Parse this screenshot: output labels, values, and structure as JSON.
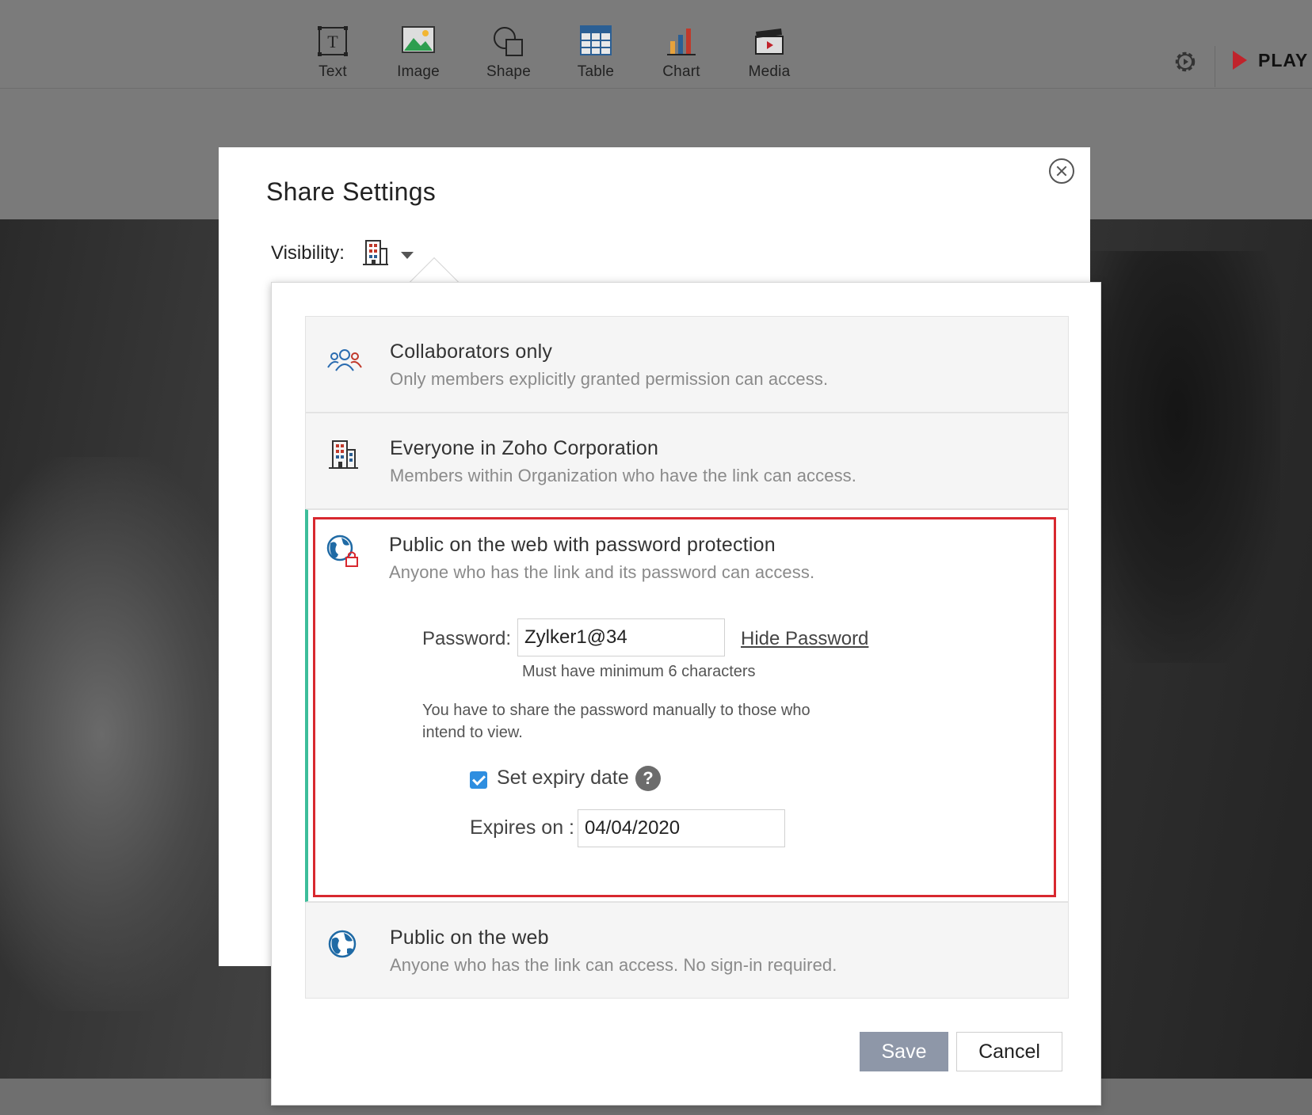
{
  "toolbar": {
    "items": [
      {
        "label": "Text",
        "icon": "text-box-icon"
      },
      {
        "label": "Image",
        "icon": "image-icon"
      },
      {
        "label": "Shape",
        "icon": "shape-icon"
      },
      {
        "label": "Table",
        "icon": "table-icon"
      },
      {
        "label": "Chart",
        "icon": "bar-chart-icon"
      },
      {
        "label": "Media",
        "icon": "clapperboard-icon"
      }
    ],
    "play_label": "PLAY"
  },
  "dialog": {
    "title": "Share Settings",
    "visibility_label": "Visibility:",
    "visibility_icon": "building-icon"
  },
  "options": [
    {
      "title": "Collaborators only",
      "desc": "Only members explicitly granted permission can access.",
      "icon": "people-icon"
    },
    {
      "title": "Everyone in Zoho Corporation",
      "desc": "Members within Organization who have the link can access.",
      "icon": "building-icon"
    },
    {
      "title": "Public on the web with password protection",
      "desc": "Anyone who has the link and its password can access.",
      "icon": "globe-lock-icon"
    },
    {
      "title": "Public on the web",
      "desc": "Anyone who has the link can access. No sign-in required.",
      "icon": "globe-icon"
    }
  ],
  "password": {
    "label": "Password:",
    "value": "Zylker1@34",
    "hide_label": "Hide Password",
    "hint": "Must have minimum 6 characters",
    "note": "You have to share the password manually to those who intend to view."
  },
  "expiry": {
    "checkbox_label": "Set expiry date",
    "checked": true,
    "help": "?",
    "expires_label": "Expires on :",
    "date_value": "04/04/2020"
  },
  "buttons": {
    "save": "Save",
    "cancel": "Cancel"
  },
  "colors": {
    "accent_green": "#3dbd9a",
    "highlight_red": "#d8282f",
    "save_button": "#8e97a8",
    "checkbox_blue": "#2e8ee0",
    "play_red": "#c0232b"
  }
}
